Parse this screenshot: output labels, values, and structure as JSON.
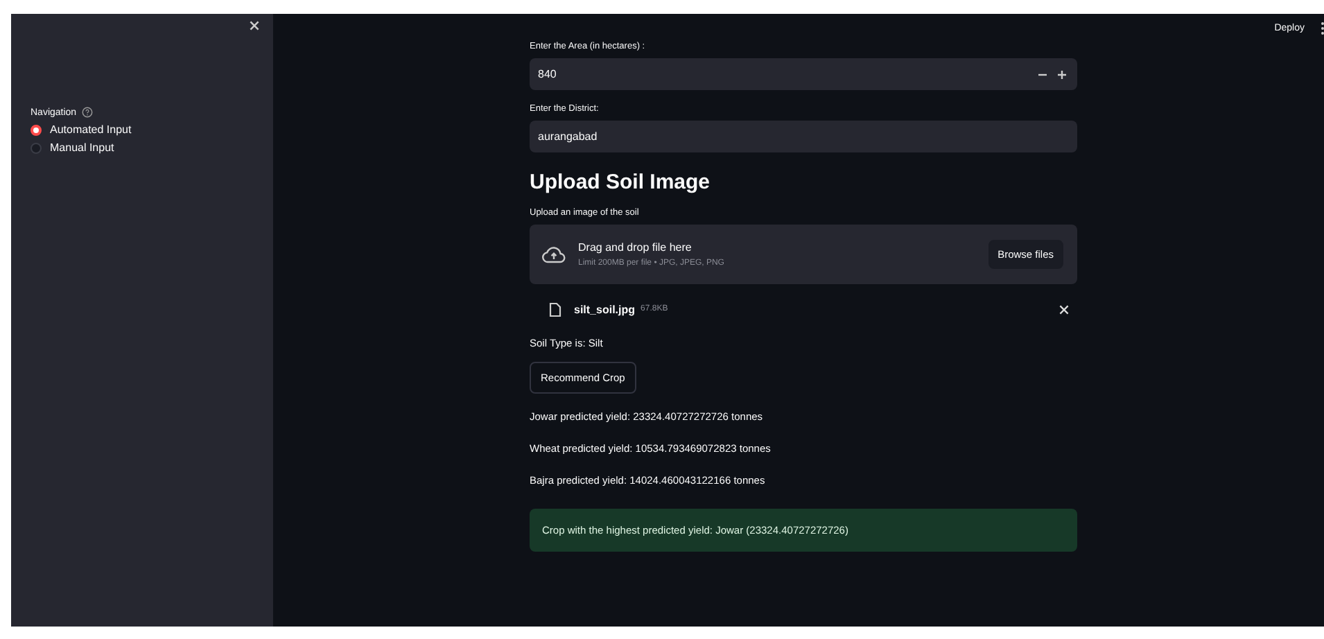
{
  "sidebar": {
    "navigation": {
      "label": "Navigation",
      "options": [
        {
          "label": "Automated Input",
          "selected": true
        },
        {
          "label": "Manual Input",
          "selected": false
        }
      ]
    }
  },
  "header": {
    "deploy": "Deploy"
  },
  "main": {
    "area": {
      "label": "Enter the Area (in hectares) :",
      "value": "840"
    },
    "district": {
      "label": "Enter the District:",
      "value": "aurangabad"
    },
    "heading": "Upload Soil Image",
    "uploader": {
      "label": "Upload an image of the soil",
      "prompt": "Drag and drop file here",
      "limit": "Limit 200MB per file • JPG, JPEG, PNG",
      "button": "Browse files"
    },
    "file": {
      "name": "silt_soil.jpg",
      "size": "67.8KB"
    },
    "soil_type": "Soil Type is: Silt",
    "recommend_button": "Recommend Crop",
    "yields": [
      "Jowar predicted yield: 23324.40727272726 tonnes",
      "Wheat predicted yield: 10534.793469072823 tonnes",
      "Bajra predicted yield: 14024.460043122166 tonnes"
    ],
    "success": "Crop with the highest predicted yield: Jowar (23324.40727272726)"
  }
}
